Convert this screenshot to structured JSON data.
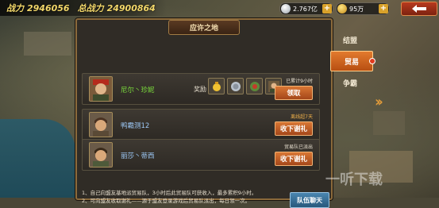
{
  "hud": {
    "stat1_label": "战力",
    "stat1_value": "2946056",
    "stat2_label": "总战力",
    "stat2_value": "24900864",
    "silver_value": "2.767亿",
    "gold_value": "95万",
    "plus": "+"
  },
  "panel": {
    "title": "应许之地"
  },
  "rows": [
    {
      "player_name": "尼尔丶珍妮",
      "reward_label": "奖励",
      "status": "已累计9小时",
      "action": "领取"
    },
    {
      "player_name": "鸭霸测12",
      "status": "离线超7天",
      "action": "收下谢礼"
    },
    {
      "player_name": "丽莎丶蒂西",
      "status": "贸易队已派出",
      "action": "收下谢礼"
    }
  ],
  "notes": [
    "1、自己向盟友基地派贸易队，3小时后此贸易队可获收入，最多累积9小时。",
    "2、可向盟友收取谢礼——源于盟友登录游戏后贸易队派出，每日领一次。"
  ],
  "team_button": "队伍聊天",
  "tabs": [
    {
      "label": "结盟",
      "active": false
    },
    {
      "label": "贸易",
      "active": true
    },
    {
      "label": "争霸",
      "active": false
    }
  ],
  "watermark": "一听下载",
  "colors": {
    "accent_orange": "#d87634",
    "name_green": "#7bdc3c",
    "name_blue": "#9cc7f5",
    "panel_border": "#8b6a3b"
  }
}
